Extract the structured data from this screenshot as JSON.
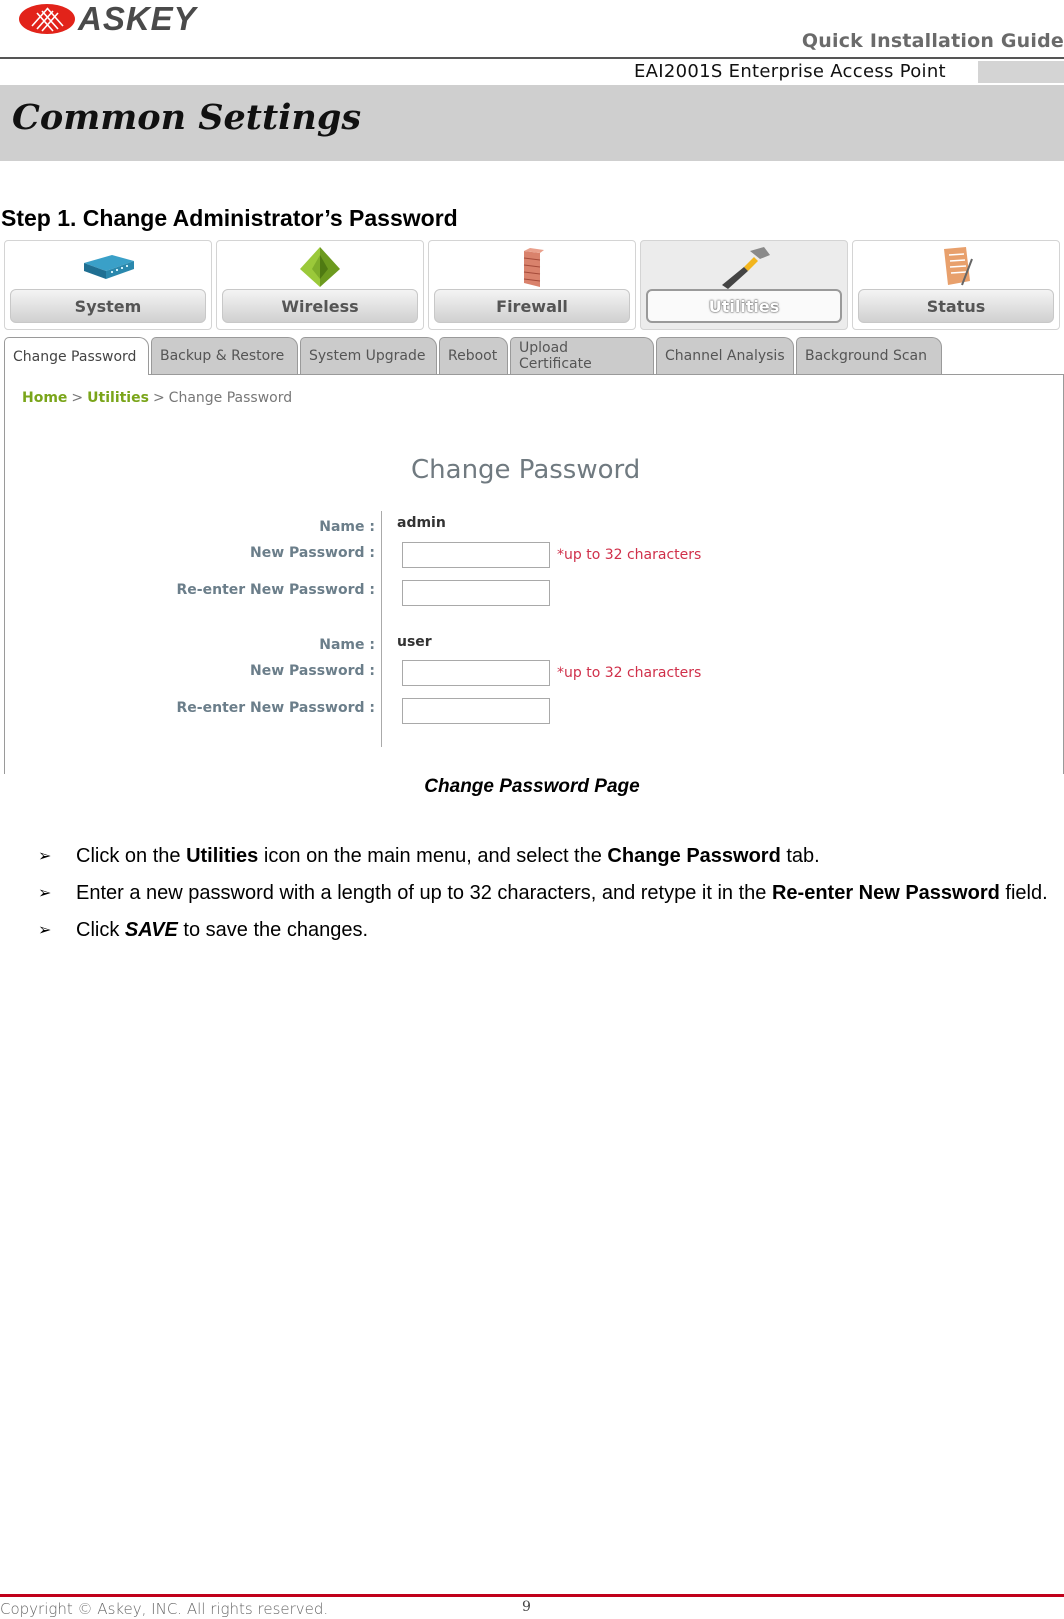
{
  "header": {
    "logo_text": "ASKEY",
    "guide_title": "Quick Installation Guide",
    "product": "EAI2001S Enterprise Access Point"
  },
  "section": {
    "title": "Common Settings",
    "step_title": "Step 1. Change Administrator’s Password"
  },
  "screenshot": {
    "main_menu": [
      {
        "label": "System",
        "icon": "router-icon",
        "active": false
      },
      {
        "label": "Wireless",
        "icon": "antenna-pyramid-icon",
        "active": false
      },
      {
        "label": "Firewall",
        "icon": "firewall-brick-icon",
        "active": false
      },
      {
        "label": "Utilities",
        "icon": "hammer-icon",
        "active": true
      },
      {
        "label": "Status",
        "icon": "notepad-icon",
        "active": false
      }
    ],
    "tabs": [
      {
        "label": "Change Password",
        "active": true
      },
      {
        "label": "Backup & Restore",
        "active": false
      },
      {
        "label": "System Upgrade",
        "active": false
      },
      {
        "label": "Reboot",
        "active": false
      },
      {
        "label": "Upload Certificate",
        "active": false
      },
      {
        "label": "Channel Analysis",
        "active": false
      },
      {
        "label": "Background Scan",
        "active": false
      }
    ],
    "breadcrumb": {
      "home": "Home",
      "section": "Utilities",
      "current": "Change Password",
      "separator": ">"
    },
    "form": {
      "title": "Change Password",
      "accounts": [
        {
          "name_label": "Name :",
          "name_value": "admin",
          "new_password_label": "New Password :",
          "new_password_value": "",
          "reenter_label": "Re-enter New Password :",
          "reenter_value": "",
          "hint": "*up to 32 characters"
        },
        {
          "name_label": "Name :",
          "name_value": "user",
          "new_password_label": "New Password :",
          "new_password_value": "",
          "reenter_label": "Re-enter New Password :",
          "reenter_value": "",
          "hint": "*up to 32 characters"
        }
      ]
    }
  },
  "caption": "Change Password Page",
  "bullets": [
    {
      "parts": [
        {
          "text": "Click on the ",
          "style": "normal"
        },
        {
          "text": "Utilities",
          "style": "bold"
        },
        {
          "text": " icon on the main menu, and select the ",
          "style": "normal"
        },
        {
          "text": "Change Password",
          "style": "bold"
        },
        {
          "text": " tab.",
          "style": "normal"
        }
      ]
    },
    {
      "parts": [
        {
          "text": "Enter a new password with a length of up to 32 characters, and retype it in the ",
          "style": "normal"
        },
        {
          "text": "Re-enter New Password",
          "style": "bold"
        },
        {
          "text": " field.",
          "style": "normal"
        }
      ]
    },
    {
      "parts": [
        {
          "text": "Click ",
          "style": "normal"
        },
        {
          "text": "SAVE",
          "style": "bold-italic"
        },
        {
          "text": " to save the changes.",
          "style": "normal"
        }
      ]
    }
  ],
  "bullet_glyph": "➢",
  "footer": {
    "copyright": "Copyright © Askey, INC. All rights reserved.",
    "page_number": "9"
  },
  "colors": {
    "brand_red": "#e2231a",
    "footer_rule": "#c0001a",
    "breadcrumb_link": "#7aa51a",
    "hint_red": "#d0304a",
    "section_band": "#cfcfcf"
  }
}
